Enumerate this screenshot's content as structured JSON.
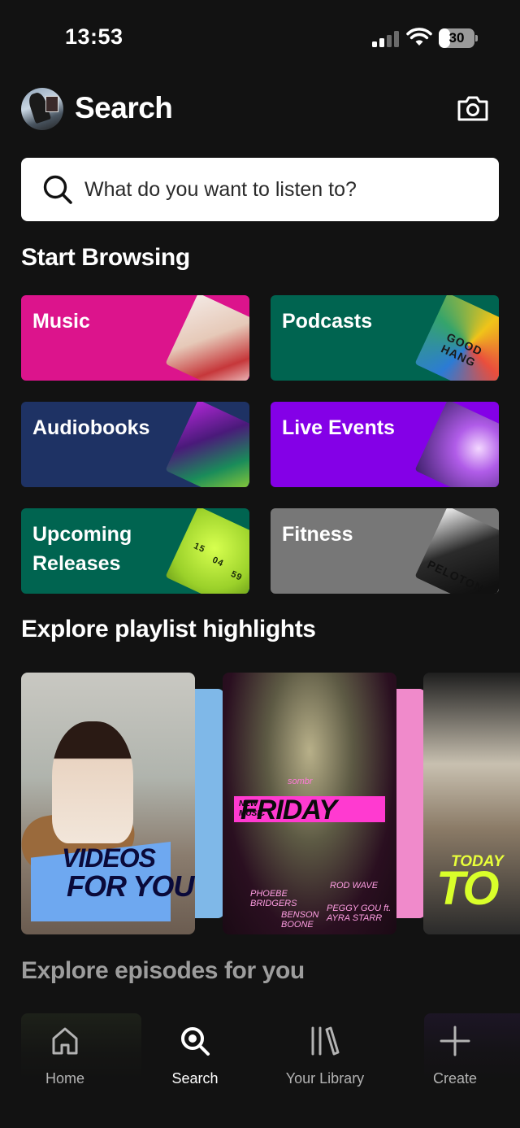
{
  "status_bar": {
    "time": "13:53",
    "battery_percent": "30"
  },
  "header": {
    "title": "Search"
  },
  "search": {
    "placeholder": "What do you want to listen to?"
  },
  "sections": {
    "browse_title": "Start Browsing",
    "playlist_title": "Explore playlist highlights",
    "episodes_title": "Explore episodes for you"
  },
  "categories": [
    {
      "label": "Music",
      "color": "#dc148c"
    },
    {
      "label": "Podcasts",
      "color": "#006450"
    },
    {
      "label": "Audiobooks",
      "color": "#1e3264"
    },
    {
      "label": "Live Events",
      "color": "#8400e7"
    },
    {
      "label": "Upcoming Releases",
      "color": "#006450"
    },
    {
      "label": "Fitness",
      "color": "#777777"
    }
  ],
  "category_art_text": {
    "podcasts": "GOOD HANG",
    "fitness": "PELOTON",
    "upcoming": [
      "15",
      "04",
      "59"
    ]
  },
  "playlists": [
    {
      "line1": "VIDEOS",
      "line2": "FOR YOU"
    },
    {
      "line1": "NEW MUSIC",
      "line2": "FRIDAY",
      "small": "sombr",
      "names": [
        "PHOEBE BRIDGERS",
        "ROD WAVE",
        "BENSON BOONE",
        "PEGGY GOU ft. AYRA STARR"
      ]
    },
    {
      "line1": "TODAY",
      "line2": "TO"
    }
  ],
  "bottom_nav": [
    {
      "label": "Home",
      "icon": "home-icon",
      "active": false
    },
    {
      "label": "Search",
      "icon": "search-icon",
      "active": true
    },
    {
      "label": "Your Library",
      "icon": "library-icon",
      "active": false
    },
    {
      "label": "Create",
      "icon": "plus-icon",
      "active": false
    }
  ],
  "colors": {
    "background": "#121212",
    "active": "#ffffff",
    "inactive": "#b3b3b3"
  }
}
